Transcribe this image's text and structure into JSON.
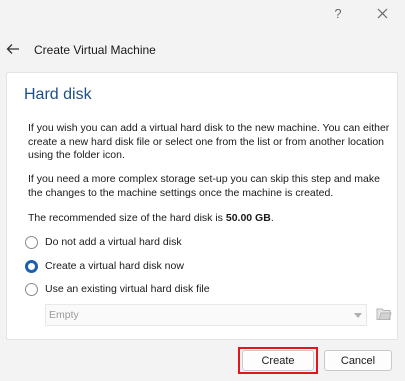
{
  "titlebar": {
    "help_label": "?",
    "close_icon": "close-icon"
  },
  "header": {
    "back_icon": "arrow-left-icon",
    "title": "Create Virtual Machine"
  },
  "section": {
    "title": "Hard disk"
  },
  "content": {
    "paragraph1": "If you wish you can add a virtual hard disk to the new machine. You can either create a new hard disk file or select one from the list or from another location using the folder icon.",
    "paragraph2": "If you need a more complex storage set-up you can skip this step and make the changes to the machine settings once the machine is created.",
    "recommend_prefix": "The recommended size of the hard disk is ",
    "recommend_size": "50.00 GB",
    "recommend_suffix": "."
  },
  "options": [
    {
      "label": "Do not add a virtual hard disk",
      "checked": false
    },
    {
      "label": "Create a virtual hard disk now",
      "checked": true
    },
    {
      "label": "Use an existing virtual hard disk file",
      "checked": false
    }
  ],
  "disk_select": {
    "value": "Empty",
    "folder_icon": "folder-open-icon"
  },
  "buttons": {
    "create": "Create",
    "cancel": "Cancel"
  },
  "colors": {
    "accent": "#1a5fb4",
    "title": "#1f4f8a",
    "highlight": "#e3161e"
  }
}
